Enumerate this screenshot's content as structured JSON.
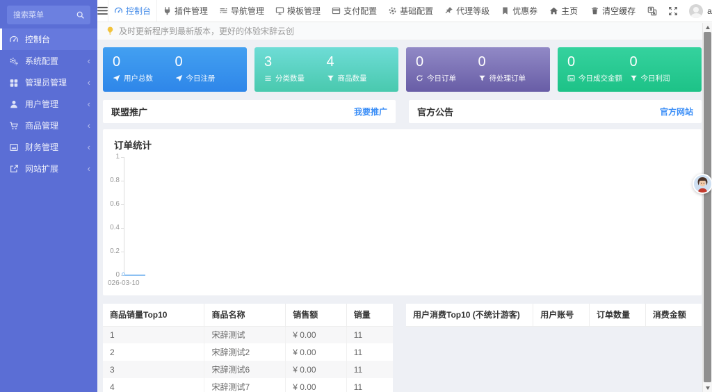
{
  "sidebar": {
    "search_placeholder": "搜索菜单",
    "items": [
      {
        "label": "控制台",
        "icon": "dashboard-icon",
        "active": true
      },
      {
        "label": "系统配置",
        "icon": "cogs-icon"
      },
      {
        "label": "管理员管理",
        "icon": "grid-icon"
      },
      {
        "label": "用户管理",
        "icon": "user-icon"
      },
      {
        "label": "商品管理",
        "icon": "cart-icon"
      },
      {
        "label": "财务管理",
        "icon": "finance-image-icon"
      },
      {
        "label": "网站扩展",
        "icon": "external-link-icon"
      }
    ]
  },
  "navbar": {
    "tabs": [
      {
        "label": "控制台",
        "icon": "dashboard-icon",
        "active": true
      },
      {
        "label": "插件管理",
        "icon": "plug-icon"
      },
      {
        "label": "导航管理",
        "icon": "nav-lines-icon"
      },
      {
        "label": "模板管理",
        "icon": "monitor-icon"
      },
      {
        "label": "支付配置",
        "icon": "credit-card-icon"
      },
      {
        "label": "基础配置",
        "icon": "gear-icon"
      },
      {
        "label": "代理等级",
        "icon": "pin-icon"
      },
      {
        "label": "优惠券",
        "icon": "bookmark-icon"
      }
    ],
    "home": "主页",
    "clear_cache": "清空缓存",
    "username": "admin"
  },
  "alert": {
    "text": "及时更新程序到最新版本，更好的体验宋辞云创"
  },
  "stat_cards": [
    {
      "theme": "blue",
      "color_top": "#43a0f1",
      "color_bottom": "#2e86e9",
      "stats": [
        {
          "value": "0",
          "label": "用户总数",
          "icon": "send-icon"
        },
        {
          "value": "0",
          "label": "今日注册",
          "icon": "send-icon"
        }
      ]
    },
    {
      "theme": "teal",
      "color_top": "#6edcd6",
      "color_bottom": "#49c9ae",
      "stats": [
        {
          "value": "3",
          "label": "分类数量",
          "icon": "list-icon"
        },
        {
          "value": "4",
          "label": "商品数量",
          "icon": "funnel-icon"
        }
      ]
    },
    {
      "theme": "purple",
      "color_top": "#9189c6",
      "color_bottom": "#685da6",
      "stats": [
        {
          "value": "0",
          "label": "今日订单",
          "icon": "refresh-icon"
        },
        {
          "value": "0",
          "label": "待处理订单",
          "icon": "funnel-icon"
        }
      ]
    },
    {
      "theme": "green",
      "color_top": "#35d29e",
      "color_bottom": "#1dc287",
      "stats": [
        {
          "value": "0",
          "label": "今日成交金额",
          "icon": "picture-icon"
        },
        {
          "value": "0",
          "label": "今日利润",
          "icon": "funnel-icon"
        }
      ]
    }
  ],
  "panels": [
    {
      "title": "联盟推广",
      "link": "我要推广"
    },
    {
      "title": "官方公告",
      "link": "官方网站"
    }
  ],
  "chart_data": {
    "type": "line",
    "title": "订单统计",
    "x": [
      "026-03-10"
    ],
    "series": [
      {
        "name": "订单统计",
        "values": [
          0
        ]
      }
    ],
    "ylim": [
      0,
      1
    ],
    "yticks": [
      "1",
      "0.8",
      "0.6",
      "0.4",
      "0.2",
      "0"
    ],
    "grid": false,
    "legend": "none",
    "line_color": "#8cc0f2"
  },
  "tables": {
    "product_top10": {
      "headers": [
        "商品销量Top10",
        "商品名称",
        "销售额",
        "销量"
      ],
      "rows": [
        [
          "1",
          "宋辞测试",
          "¥ 0.00",
          "11"
        ],
        [
          "2",
          "宋辞测试2",
          "¥ 0.00",
          "11"
        ],
        [
          "3",
          "宋辞测试6",
          "¥ 0.00",
          "11"
        ],
        [
          "4",
          "宋辞测试7",
          "¥ 0.00",
          "11"
        ]
      ]
    },
    "user_top10": {
      "headers": [
        "用户消费Top10 (不统计游客)",
        "用户账号",
        "订单数量",
        "消费金额"
      ],
      "rows": []
    }
  },
  "colors": {
    "sidebar_bg": "#5b6ed5",
    "accent_blue": "#3e90f7",
    "page_bg": "#eef0f5",
    "active_tab": "#4a8fe9"
  }
}
